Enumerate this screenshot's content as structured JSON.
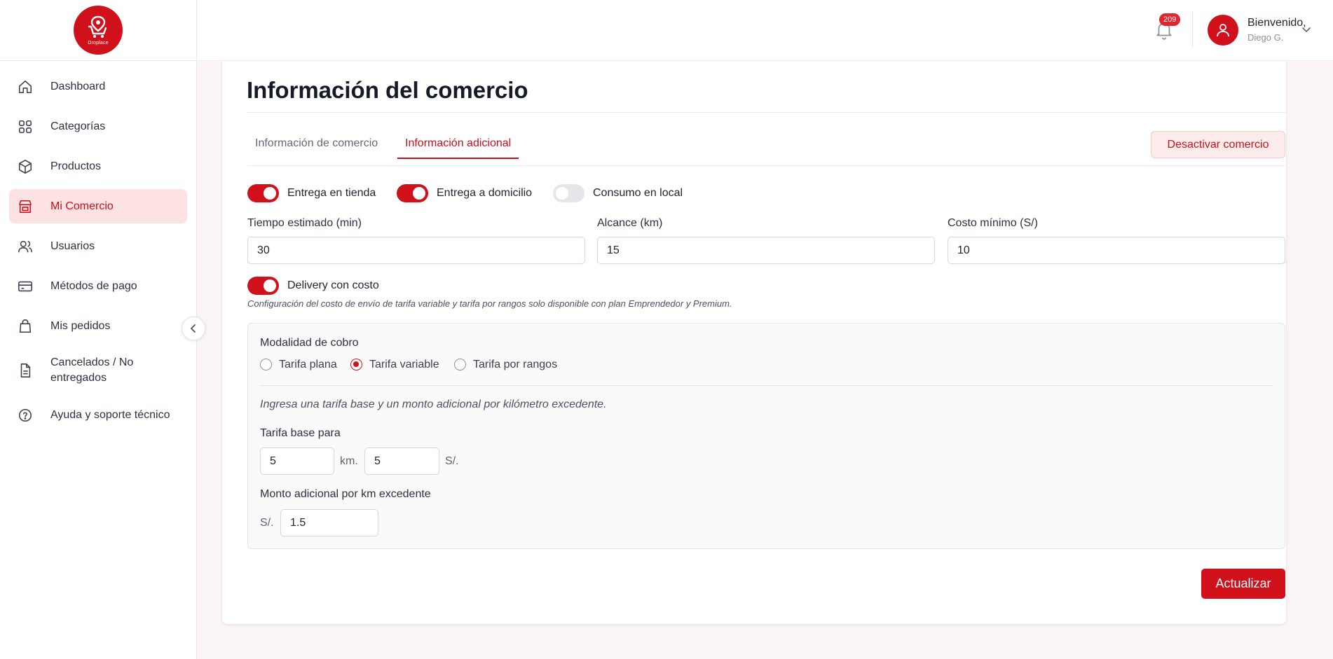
{
  "brand": {
    "logo_text": "Droplace",
    "accent_color": "#d0111b"
  },
  "sidebar": {
    "items": [
      {
        "label": "Dashboard",
        "icon": "home-icon"
      },
      {
        "label": "Categorías",
        "icon": "grid-icon"
      },
      {
        "label": "Productos",
        "icon": "box-icon"
      },
      {
        "label": "Mi Comercio",
        "icon": "store-icon",
        "active": true
      },
      {
        "label": "Usuarios",
        "icon": "users-icon"
      },
      {
        "label": "Métodos de pago",
        "icon": "credit-card-icon"
      },
      {
        "label": "Mis pedidos",
        "icon": "shopping-bag-icon"
      },
      {
        "label": "Cancelados / No entregados",
        "icon": "document-icon"
      },
      {
        "label": "Ayuda y soporte técnico",
        "icon": "help-circle-icon"
      }
    ]
  },
  "header": {
    "notification_count": "209",
    "welcome": "Bienvenido,",
    "username": "Diego G."
  },
  "page": {
    "title": "Información del comercio",
    "tabs": [
      {
        "label": "Información de comercio",
        "active": false
      },
      {
        "label": "Información adicional",
        "active": true
      }
    ],
    "deactivate_label": "Desactivar comercio"
  },
  "delivery_options": {
    "store_pickup": {
      "label": "Entrega en tienda",
      "enabled": true
    },
    "home_delivery": {
      "label": "Entrega a domicilio",
      "enabled": true
    },
    "dine_in": {
      "label": "Consumo en local",
      "enabled": false
    }
  },
  "fields": {
    "estimated_time": {
      "label": "Tiempo estimado (min)",
      "value": "30"
    },
    "range": {
      "label": "Alcance (km)",
      "value": "15"
    },
    "min_cost": {
      "label": "Costo mínimo (S/)",
      "value": "10"
    }
  },
  "delivery_cost": {
    "label": "Delivery con costo",
    "enabled": true,
    "note": "Configuración del costo de envío de tarifa variable y tarifa por rangos solo disponible con plan Emprendedor y Premium."
  },
  "billing": {
    "title": "Modalidad de cobro",
    "options": [
      {
        "label": "Tarifa plana",
        "checked": false
      },
      {
        "label": "Tarifa variable",
        "checked": true
      },
      {
        "label": "Tarifa por rangos",
        "checked": false
      }
    ],
    "hint": "Ingresa una tarifa base y un monto adicional por kilómetro excedente.",
    "base_rate_label": "Tarifa base para",
    "base_km_value": "5",
    "km_unit": "km.",
    "base_price_value": "5",
    "currency_unit": "S/.",
    "extra_label": "Monto adicional por km excedente",
    "extra_currency": "S/.",
    "extra_value": "1.5"
  },
  "actions": {
    "update_label": "Actualizar"
  }
}
